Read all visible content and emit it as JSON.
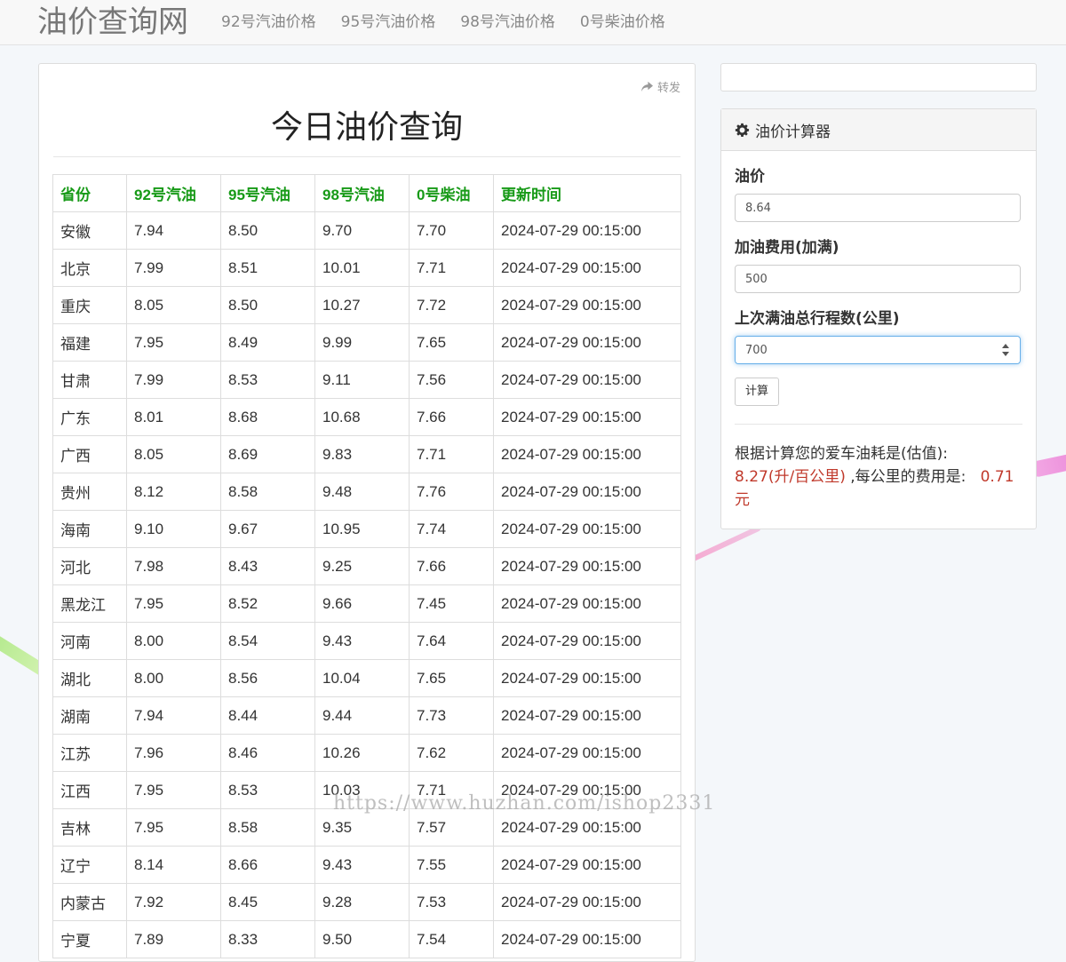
{
  "navbar": {
    "brand": "油价查询网",
    "links": [
      "92号汽油价格",
      "95号汽油价格",
      "98号汽油价格",
      "0号柴油价格"
    ]
  },
  "main": {
    "share_label": "转发",
    "title": "今日油价查询",
    "table": {
      "headers": [
        "省份",
        "92号汽油",
        "95号汽油",
        "98号汽油",
        "0号柴油",
        "更新时间"
      ],
      "rows": [
        [
          "安徽",
          "7.94",
          "8.50",
          "9.70",
          "7.70",
          "2024-07-29 00:15:00"
        ],
        [
          "北京",
          "7.99",
          "8.51",
          "10.01",
          "7.71",
          "2024-07-29 00:15:00"
        ],
        [
          "重庆",
          "8.05",
          "8.50",
          "10.27",
          "7.72",
          "2024-07-29 00:15:00"
        ],
        [
          "福建",
          "7.95",
          "8.49",
          "9.99",
          "7.65",
          "2024-07-29 00:15:00"
        ],
        [
          "甘肃",
          "7.99",
          "8.53",
          "9.11",
          "7.56",
          "2024-07-29 00:15:00"
        ],
        [
          "广东",
          "8.01",
          "8.68",
          "10.68",
          "7.66",
          "2024-07-29 00:15:00"
        ],
        [
          "广西",
          "8.05",
          "8.69",
          "9.83",
          "7.71",
          "2024-07-29 00:15:00"
        ],
        [
          "贵州",
          "8.12",
          "8.58",
          "9.48",
          "7.76",
          "2024-07-29 00:15:00"
        ],
        [
          "海南",
          "9.10",
          "9.67",
          "10.95",
          "7.74",
          "2024-07-29 00:15:00"
        ],
        [
          "河北",
          "7.98",
          "8.43",
          "9.25",
          "7.66",
          "2024-07-29 00:15:00"
        ],
        [
          "黑龙江",
          "7.95",
          "8.52",
          "9.66",
          "7.45",
          "2024-07-29 00:15:00"
        ],
        [
          "河南",
          "8.00",
          "8.54",
          "9.43",
          "7.64",
          "2024-07-29 00:15:00"
        ],
        [
          "湖北",
          "8.00",
          "8.56",
          "10.04",
          "7.65",
          "2024-07-29 00:15:00"
        ],
        [
          "湖南",
          "7.94",
          "8.44",
          "9.44",
          "7.73",
          "2024-07-29 00:15:00"
        ],
        [
          "江苏",
          "7.96",
          "8.46",
          "10.26",
          "7.62",
          "2024-07-29 00:15:00"
        ],
        [
          "江西",
          "7.95",
          "8.53",
          "10.03",
          "7.71",
          "2024-07-29 00:15:00"
        ],
        [
          "吉林",
          "7.95",
          "8.58",
          "9.35",
          "7.57",
          "2024-07-29 00:15:00"
        ],
        [
          "辽宁",
          "8.14",
          "8.66",
          "9.43",
          "7.55",
          "2024-07-29 00:15:00"
        ],
        [
          "内蒙古",
          "7.92",
          "8.45",
          "9.28",
          "7.53",
          "2024-07-29 00:15:00"
        ],
        [
          "宁夏",
          "7.89",
          "8.33",
          "9.50",
          "7.54",
          "2024-07-29 00:15:00"
        ]
      ]
    }
  },
  "watermark": "https://www.huzhan.com/ishop2331",
  "calculator": {
    "title": "油价计算器",
    "price_label": "油价",
    "price_value": "8.64",
    "fuel_cost_label": "加油费用(加满)",
    "fuel_cost_value": "500",
    "mileage_label": "上次满油总行程数(公里)",
    "mileage_value": "700",
    "button_label": "计算",
    "result_prefix": "根据计算您的爱车油耗是(估值):",
    "result_consumption": "8.27(升/百公里)",
    "result_middle": " ,每公里的费用是:",
    "result_cost": "0.71",
    "result_unit": "元"
  },
  "colors": {
    "header_text": "#179a17",
    "result_highlight": "#c0392b",
    "focus_border": "#66afe9"
  },
  "icons": {
    "share": "share-arrow-icon",
    "calculator": "gear-icon",
    "spinner": "spinner-arrows-icon"
  }
}
